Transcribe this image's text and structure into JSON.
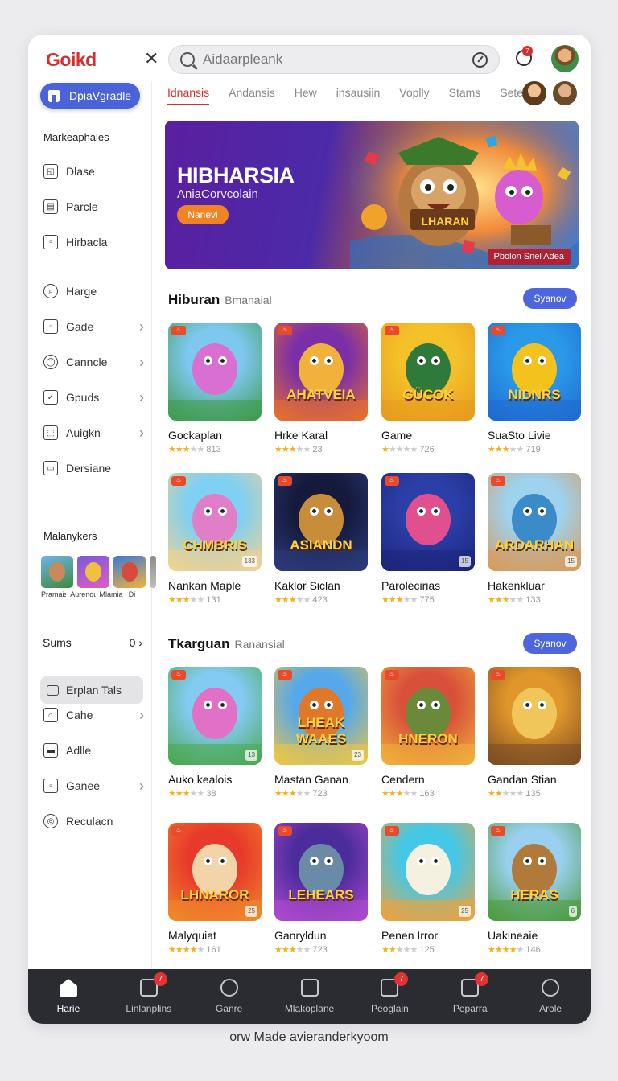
{
  "app": {
    "logo": "Goikd",
    "footer": "orw Made avieranderkyoom"
  },
  "search": {
    "placeholder": "Aidaarpleank",
    "value": ""
  },
  "header": {
    "notification_count": "7"
  },
  "tabs": [
    {
      "label": "Idnansis",
      "active": true
    },
    {
      "label": "Andansis",
      "active": false
    },
    {
      "label": "Hew",
      "active": false
    },
    {
      "label": "insausiin",
      "active": false
    },
    {
      "label": "Voplly",
      "active": false
    },
    {
      "label": "Stams",
      "active": false
    },
    {
      "label": "Setes",
      "active": false
    }
  ],
  "sidebar": {
    "upgrade_label": "DpiaVgradle",
    "section1": "Markeaphales",
    "items1": [
      {
        "label": "Dlase",
        "icon": "chat-icon"
      },
      {
        "label": "Parcle",
        "icon": "document-icon"
      },
      {
        "label": "Hirbacla",
        "icon": "box-icon"
      }
    ],
    "items2": [
      {
        "label": "Harge",
        "icon": "search-icon",
        "chevron": false
      },
      {
        "label": "Gade",
        "icon": "box-icon",
        "chevron": true
      },
      {
        "label": "Canncle",
        "icon": "user-icon",
        "chevron": true
      },
      {
        "label": "Gpuds",
        "icon": "check-icon",
        "chevron": true
      },
      {
        "label": "Auigkn",
        "icon": "tag-icon",
        "chevron": true
      },
      {
        "label": "Dersiane",
        "icon": "image-icon",
        "chevron": false
      }
    ],
    "section2": "Malanykers",
    "thumbs": [
      {
        "label": "Pramais"
      },
      {
        "label": "Aurendu"
      },
      {
        "label": "Mlamia"
      },
      {
        "label": "Di"
      }
    ],
    "sums_label": "Sums",
    "sums_value": "0 ›",
    "button_label": "Erplan Tals",
    "items3": [
      {
        "label": "Cahe",
        "icon": "home-icon",
        "chevron": true
      },
      {
        "label": "Adlle",
        "icon": "card-icon",
        "chevron": false
      },
      {
        "label": "Ganee",
        "icon": "box-icon",
        "chevron": true
      },
      {
        "label": "Reculacn",
        "icon": "settings-icon",
        "chevron": false
      }
    ]
  },
  "banner": {
    "title": "HIBHARSIA",
    "subtitle": "AniaCorvcolain",
    "button": "Nanevi",
    "art_text": "LHARAN",
    "tag": "Pbolon Snel Adea"
  },
  "section1": {
    "title": "Hiburan",
    "subtitle": "Bmanaial",
    "button": "Syanov",
    "cards": [
      {
        "name": "Gockaplan",
        "stars": 3,
        "rating": "813",
        "word": "",
        "count": "",
        "palette": [
          "#7ec8f0",
          "#3e9b4a",
          "#d96fd0"
        ]
      },
      {
        "name": "Hrke Karal",
        "stars": 3,
        "rating": "23",
        "word": "AHATVEIA",
        "count": "",
        "palette": [
          "#7a2fa8",
          "#e8712c",
          "#f0b23a"
        ]
      },
      {
        "name": "Game",
        "stars": 1,
        "rating": "726",
        "word": "GÜCOK",
        "count": "",
        "palette": [
          "#f5c12a",
          "#e89a1e",
          "#2f7a3a"
        ]
      },
      {
        "name": "SuaSto Livie",
        "stars": 3,
        "rating": "719",
        "word": "NIDNRS",
        "count": "",
        "palette": [
          "#2a9ae8",
          "#1f6ad0",
          "#f3c21d"
        ]
      },
      {
        "name": "Nankan Maple",
        "stars": 3,
        "rating": "131",
        "word": "CHMBRIS",
        "count": "133",
        "palette": [
          "#7fd0f2",
          "#f3d28e",
          "#e07fc8"
        ]
      },
      {
        "name": "Kaklor Siclan",
        "stars": 3,
        "rating": "423",
        "word": "ASIANDN",
        "count": "",
        "palette": [
          "#151a3c",
          "#2c3b7a",
          "#c78d3a"
        ]
      },
      {
        "name": "Parolecirias",
        "stars": 3,
        "rating": "775",
        "word": "",
        "count": "15",
        "palette": [
          "#2b3fa8",
          "#1c257a",
          "#e04f8e"
        ]
      },
      {
        "name": "Hakenkluar",
        "stars": 3,
        "rating": "133",
        "word": "ARDARHAN",
        "count": "15",
        "palette": [
          "#9ed2ef",
          "#d99a5a",
          "#3b8bc9"
        ]
      }
    ]
  },
  "section2": {
    "title": "Tkarguan",
    "subtitle": "Ranansial",
    "button": "Syanov",
    "cards": [
      {
        "name": "Auko kealois",
        "stars": 3,
        "rating": "38",
        "word": "",
        "count": "13",
        "palette": [
          "#83cbf2",
          "#4aa84e",
          "#e071c6"
        ]
      },
      {
        "name": "Mastan Ganan",
        "stars": 3,
        "rating": "723",
        "word": "LHEAK WAAES",
        "count": "23",
        "palette": [
          "#56a8ea",
          "#f0c642",
          "#e0782a"
        ]
      },
      {
        "name": "Cendern",
        "stars": 3,
        "rating": "163",
        "word": "HNERON",
        "count": "",
        "palette": [
          "#d9503a",
          "#f0b23a",
          "#6a8a3a"
        ]
      },
      {
        "name": "Gandan Stian",
        "stars": 2,
        "rating": "135",
        "word": "",
        "count": "",
        "palette": [
          "#e0962a",
          "#7a4b24",
          "#f0c65a"
        ]
      },
      {
        "name": "Malyquiat",
        "stars": 4,
        "rating": "161",
        "word": "LHNAROR",
        "count": "25",
        "palette": [
          "#e83a2a",
          "#f08a2c",
          "#f3d3a8"
        ]
      },
      {
        "name": "Ganryldun",
        "stars": 3,
        "rating": "723",
        "word": "LEHEARS",
        "count": "",
        "palette": [
          "#4a2c9a",
          "#b04ad0",
          "#6a8aa8"
        ]
      },
      {
        "name": "Penen Irror",
        "stars": 2,
        "rating": "125",
        "word": "",
        "count": "25",
        "palette": [
          "#44c8e8",
          "#f0a23a",
          "#f6f0e0"
        ]
      },
      {
        "name": "Uakineaie",
        "stars": 4,
        "rating": "146",
        "word": "HERAS",
        "count": "6",
        "palette": [
          "#9ad0ef",
          "#4a9a3a",
          "#b07a3a"
        ]
      }
    ]
  },
  "bottom_nav": [
    {
      "label": "Harie",
      "icon": "home-icon",
      "badge": "",
      "active": true
    },
    {
      "label": "Linlanplins",
      "icon": "inbox-icon",
      "badge": "7",
      "active": false
    },
    {
      "label": "Ganre",
      "icon": "search-icon",
      "badge": "",
      "active": false
    },
    {
      "label": "Mlakoplane",
      "icon": "dice-icon",
      "badge": "",
      "active": false
    },
    {
      "label": "Peoglain",
      "icon": "smile-icon",
      "badge": "7",
      "active": false
    },
    {
      "label": "Peparra",
      "icon": "edit-icon",
      "badge": "7",
      "active": false
    },
    {
      "label": "Arole",
      "icon": "user-icon",
      "badge": "",
      "active": false
    }
  ],
  "colors": {
    "brand": "#d42e2e",
    "accent": "#4a63d8",
    "nav_bg": "#2b2c31",
    "star": "#f2b01e"
  }
}
